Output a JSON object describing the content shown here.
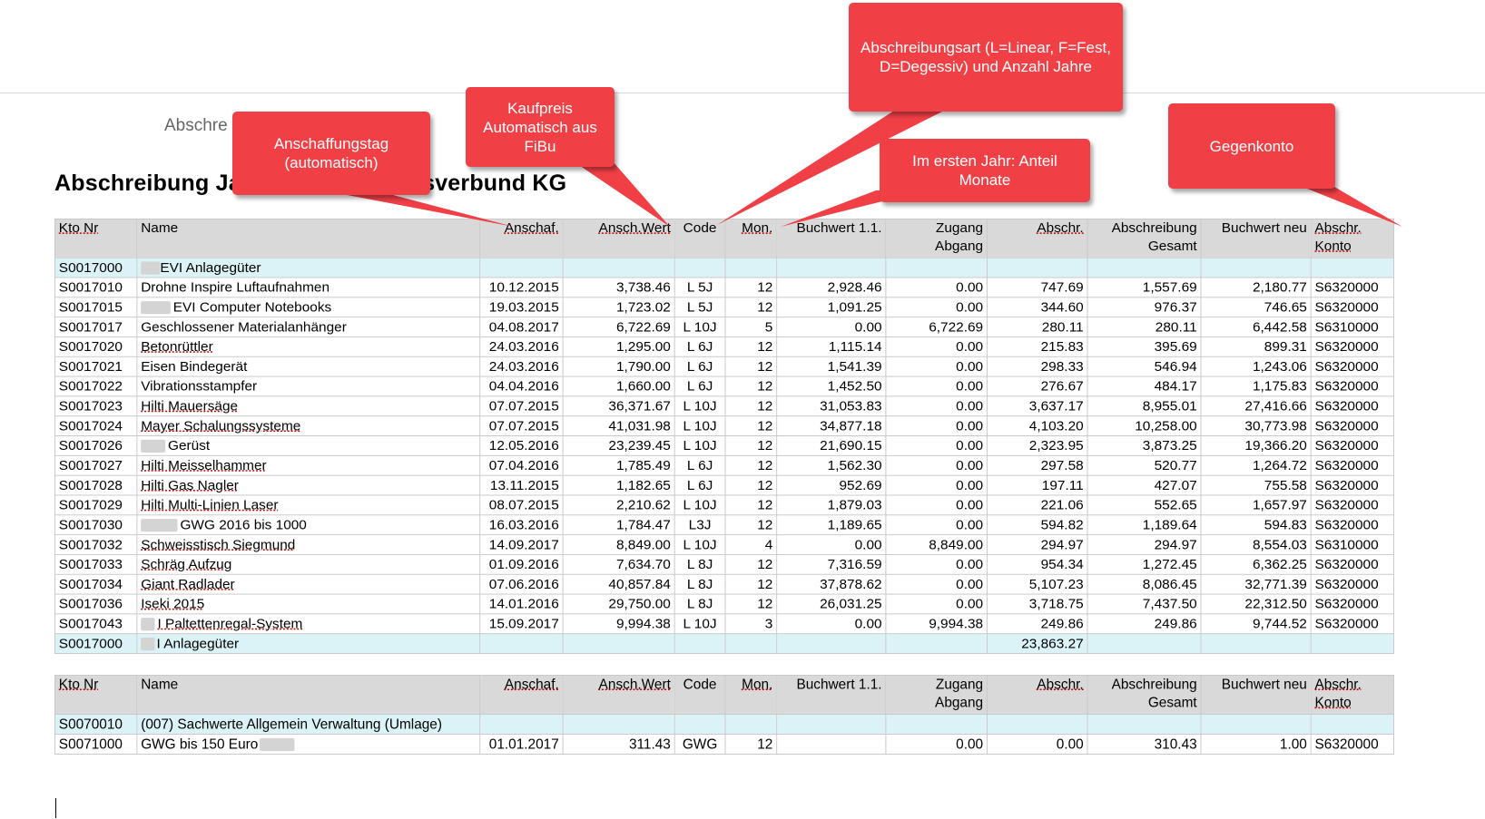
{
  "document": {
    "subtitle": "Abschre",
    "title": "Abschreibung Ja                    nt 5 EVI Einkaufsverbund KG"
  },
  "headers": {
    "kto": "Kto Nr",
    "name": "Name",
    "anschaf": "Anschaf.",
    "anschwert": "Ansch.Wert",
    "code": "Code",
    "mon": "Mon.",
    "buchwert11": "Buchwert 1.1.",
    "zugang": "Zugang Abgang",
    "abschr": "Abschr.",
    "abschr_gesamt": "Abschreibung Gesamt",
    "buchwert_neu": "Buchwert neu",
    "abschr_konto": "Abschr. Konto"
  },
  "table1": {
    "group_row": {
      "kto": "S0017000",
      "name": "EVI Anlagegüter"
    },
    "rows": [
      {
        "kto": "S0017010",
        "name": "Drohne Inspire Luftaufnahmen",
        "anschaf": "10.12.2015",
        "wert": "3,738.46",
        "code": "L 5J",
        "mon": "12",
        "bw": "2,928.46",
        "zugang": "0.00",
        "abschr": "747.69",
        "gesamt": "1,557.69",
        "neu": "2,180.77",
        "konto": "S6320000"
      },
      {
        "kto": "S0017015",
        "name": "EVI Computer Notebooks",
        "anschaf": "19.03.2015",
        "wert": "1,723.02",
        "code": "L 5J",
        "mon": "12",
        "bw": "1,091.25",
        "zugang": "0.00",
        "abschr": "344.60",
        "gesamt": "976.37",
        "neu": "746.65",
        "konto": "S6320000"
      },
      {
        "kto": "S0017017",
        "name": "Geschlossener Materialanhänger",
        "anschaf": "04.08.2017",
        "wert": "6,722.69",
        "code": "L 10J",
        "mon": "5",
        "bw": "0.00",
        "zugang": "6,722.69",
        "abschr": "280.11",
        "gesamt": "280.11",
        "neu": "6,442.58",
        "konto": "S6310000"
      },
      {
        "kto": "S0017020",
        "name": "Betonrüttler",
        "anschaf": "24.03.2016",
        "wert": "1,295.00",
        "code": "L 6J",
        "mon": "12",
        "bw": "1,115.14",
        "zugang": "0.00",
        "abschr": "215.83",
        "gesamt": "395.69",
        "neu": "899.31",
        "konto": "S6320000"
      },
      {
        "kto": "S0017021",
        "name": "Eisen Bindegerät",
        "anschaf": "24.03.2016",
        "wert": "1,790.00",
        "code": "L 6J",
        "mon": "12",
        "bw": "1,541.39",
        "zugang": "0.00",
        "abschr": "298.33",
        "gesamt": "546.94",
        "neu": "1,243.06",
        "konto": "S6320000"
      },
      {
        "kto": "S0017022",
        "name": "Vibrationsstampfer",
        "anschaf": "04.04.2016",
        "wert": "1,660.00",
        "code": "L 6J",
        "mon": "12",
        "bw": "1,452.50",
        "zugang": "0.00",
        "abschr": "276.67",
        "gesamt": "484.17",
        "neu": "1,175.83",
        "konto": "S6320000"
      },
      {
        "kto": "S0017023",
        "name": "Hilti Mauersäge",
        "anschaf": "07.07.2015",
        "wert": "36,371.67",
        "code": "L 10J",
        "mon": "12",
        "bw": "31,053.83",
        "zugang": "0.00",
        "abschr": "3,637.17",
        "gesamt": "8,955.01",
        "neu": "27,416.66",
        "konto": "S6320000"
      },
      {
        "kto": "S0017024",
        "name": "Mayer Schalungssysteme",
        "anschaf": "07.07.2015",
        "wert": "41,031.98",
        "code": "L 10J",
        "mon": "12",
        "bw": "34,877.18",
        "zugang": "0.00",
        "abschr": "4,103.20",
        "gesamt": "10,258.00",
        "neu": "30,773.98",
        "konto": "S6320000"
      },
      {
        "kto": "S0017026",
        "name": "Gerüst",
        "anschaf": "12.05.2016",
        "wert": "23,239.45",
        "code": "L 10J",
        "mon": "12",
        "bw": "21,690.15",
        "zugang": "0.00",
        "abschr": "2,323.95",
        "gesamt": "3,873.25",
        "neu": "19,366.20",
        "konto": "S6320000"
      },
      {
        "kto": "S0017027",
        "name": "Hilti Meisselhammer",
        "anschaf": "07.04.2016",
        "wert": "1,785.49",
        "code": "L 6J",
        "mon": "12",
        "bw": "1,562.30",
        "zugang": "0.00",
        "abschr": "297.58",
        "gesamt": "520.77",
        "neu": "1,264.72",
        "konto": "S6320000"
      },
      {
        "kto": "S0017028",
        "name": "Hilti Gas Nagler",
        "anschaf": "13.11.2015",
        "wert": "1,182.65",
        "code": "L 6J",
        "mon": "12",
        "bw": "952.69",
        "zugang": "0.00",
        "abschr": "197.11",
        "gesamt": "427.07",
        "neu": "755.58",
        "konto": "S6320000"
      },
      {
        "kto": "S0017029",
        "name": "Hilti Multi-Linien Laser",
        "anschaf": "08.07.2015",
        "wert": "2,210.62",
        "code": "L 10J",
        "mon": "12",
        "bw": "1,879.03",
        "zugang": "0.00",
        "abschr": "221.06",
        "gesamt": "552.65",
        "neu": "1,657.97",
        "konto": "S6320000"
      },
      {
        "kto": "S0017030",
        "name": "GWG 2016 bis 1000",
        "anschaf": "16.03.2016",
        "wert": "1,784.47",
        "code": "L3J",
        "mon": "12",
        "bw": "1,189.65",
        "zugang": "0.00",
        "abschr": "594.82",
        "gesamt": "1,189.64",
        "neu": "594.83",
        "konto": "S6320000"
      },
      {
        "kto": "S0017032",
        "name": "Schweisstisch Siegmund",
        "anschaf": "14.09.2017",
        "wert": "8,849.00",
        "code": "L 10J",
        "mon": "4",
        "bw": "0.00",
        "zugang": "8,849.00",
        "abschr": "294.97",
        "gesamt": "294.97",
        "neu": "8,554.03",
        "konto": "S6310000"
      },
      {
        "kto": "S0017033",
        "name": "Schräg Aufzug",
        "anschaf": "01.09.2016",
        "wert": "7,634.70",
        "code": "L 8J",
        "mon": "12",
        "bw": "7,316.59",
        "zugang": "0.00",
        "abschr": "954.34",
        "gesamt": "1,272.45",
        "neu": "6,362.25",
        "konto": "S6320000"
      },
      {
        "kto": "S0017034",
        "name": "Giant Radlader",
        "anschaf": "07.06.2016",
        "wert": "40,857.84",
        "code": "L 8J",
        "mon": "12",
        "bw": "37,878.62",
        "zugang": "0.00",
        "abschr": "5,107.23",
        "gesamt": "8,086.45",
        "neu": "32,771.39",
        "konto": "S6320000"
      },
      {
        "kto": "S0017036",
        "name": "Iseki 2015",
        "anschaf": "14.01.2016",
        "wert": "29,750.00",
        "code": "L 8J",
        "mon": "12",
        "bw": "26,031.25",
        "zugang": "0.00",
        "abschr": "3,718.75",
        "gesamt": "7,437.50",
        "neu": "22,312.50",
        "konto": "S6320000"
      },
      {
        "kto": "S0017043",
        "name": "I Paltettenregal-System",
        "anschaf": "15.09.2017",
        "wert": "9,994.38",
        "code": "L 10J",
        "mon": "3",
        "bw": "0.00",
        "zugang": "9,994.38",
        "abschr": "249.86",
        "gesamt": "249.86",
        "neu": "9,744.52",
        "konto": "S6320000"
      }
    ],
    "total_row": {
      "kto": "S0017000",
      "name": "I Anlagegüter",
      "abschr": "23,863.27"
    }
  },
  "table2": {
    "group_row": {
      "kto": "S0070010",
      "name": "(007) Sachwerte Allgemein Verwaltung (Umlage)"
    },
    "rows": [
      {
        "kto": "S0071000",
        "name": "GWG bis 150 Euro",
        "anschaf": "01.01.2017",
        "wert": "311.43",
        "code": "GWG",
        "mon": "12",
        "bw": "",
        "zugang": "0.00",
        "abschr": "0.00",
        "gesamt": "310.43",
        "neu": "1.00",
        "konto": "S6320000"
      }
    ]
  },
  "callouts": {
    "anschaffungstag": "Anschaffungstag (automatisch)",
    "kaufpreis": "Kaufpreis Automatisch aus FiBu",
    "abschreibungsart": "Abschreibungsart (L=Linear, F=Fest, D=Degessiv) und Anzahl Jahre",
    "erstes_jahr": "Im ersten Jahr: Anteil Monate",
    "gegenkonto": "Gegenkonto"
  },
  "colors": {
    "callout": "#f04046",
    "header": "#d9d9d9",
    "group": "#dbf3f7"
  }
}
